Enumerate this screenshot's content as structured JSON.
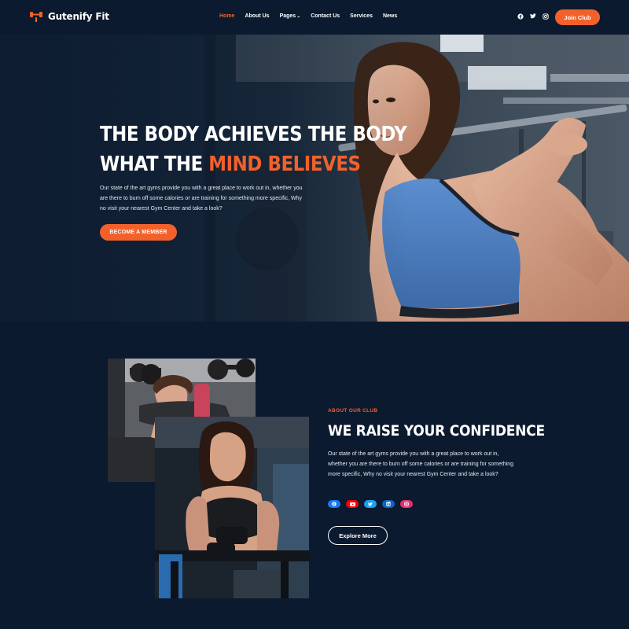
{
  "brand": {
    "name": "Gutenify Fit",
    "accent": "#f2612b",
    "background": "#0b1a2e"
  },
  "nav": {
    "items": [
      {
        "label": "Home",
        "active": true
      },
      {
        "label": "About Us"
      },
      {
        "label": "Pages"
      },
      {
        "label": "Contact Us"
      },
      {
        "label": "Services"
      },
      {
        "label": "News"
      }
    ],
    "socials": [
      "facebook-icon",
      "twitter-icon",
      "instagram-icon"
    ],
    "cta": "Join Club"
  },
  "hero": {
    "title_line1": "THE BODY ACHIEVES THE BODY",
    "title_line2_prefix": "WHAT THE ",
    "title_line2_accent": "MIND BELIEVES",
    "text": "Our state of the art gyms provide you with a great place to work out in, whether you are there to burn off some calories or are training for something more specific, Why no visit your nearest Gym Center and take a look?",
    "button": "BECOME A MEMBER"
  },
  "about": {
    "kicker": "ABOUT OUR CLUB",
    "title": "WE RAISE YOUR CONFIDENCE",
    "text": "Our state of the art gyms provide you with a great place to work out in, whether you are there to burn off some calories or are training for something more specific, Why no visit your nearest Gym Center and take a look?",
    "socials": [
      {
        "icon": "facebook-icon",
        "color": "#1877f2"
      },
      {
        "icon": "youtube-icon",
        "color": "#ff0000"
      },
      {
        "icon": "twitter-icon",
        "color": "#1da1f2"
      },
      {
        "icon": "linkedin-icon",
        "color": "#0a66c2"
      },
      {
        "icon": "instagram-icon",
        "color": "#e1306c"
      }
    ],
    "button": "Explore More"
  }
}
